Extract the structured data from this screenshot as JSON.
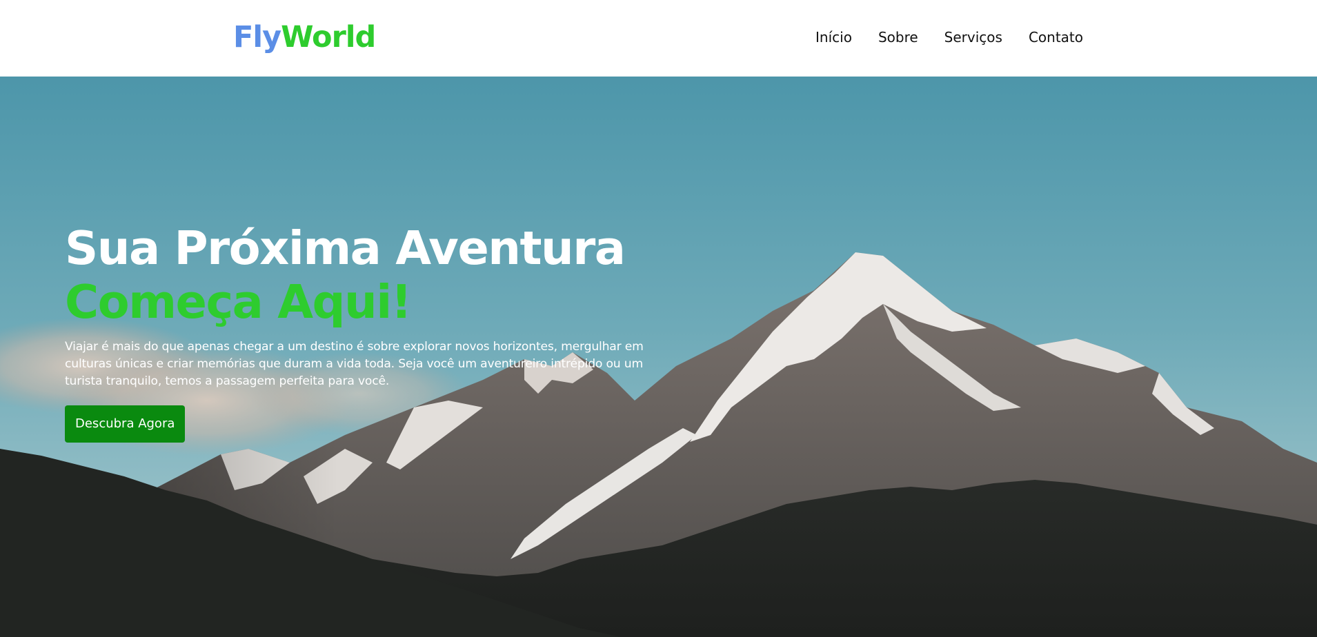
{
  "header": {
    "logo": {
      "part1": "Fly",
      "part2": "World"
    },
    "nav": [
      {
        "label": "Início"
      },
      {
        "label": "Sobre"
      },
      {
        "label": "Serviços"
      },
      {
        "label": "Contato"
      }
    ]
  },
  "hero": {
    "title_line1": "Sua Próxima Aventura",
    "title_line2": "Começa Aqui!",
    "description": "Viajar é mais do que apenas chegar a um destino é sobre explorar novos horizontes, mergulhar em culturas únicas e criar memórias que duram a vida toda. Seja você um aventureiro intrépido ou um turista tranquilo, temos a passagem perfeita para você.",
    "cta_label": "Descubra Agora",
    "background_image": "snowy-mountain-landscape"
  },
  "colors": {
    "logo_fly": "#5b8ee6",
    "logo_world": "#2ecc2e",
    "title_accent": "#2ecc2e",
    "cta_background": "#0a8a0f"
  }
}
